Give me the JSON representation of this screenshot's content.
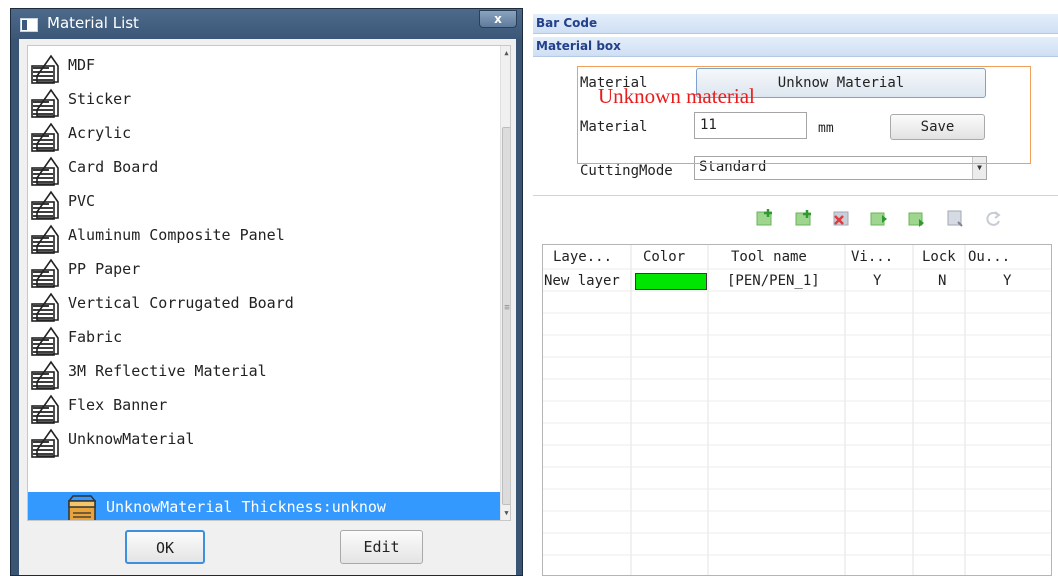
{
  "dialog": {
    "title": "Material List",
    "close_label": "x",
    "materials": [
      "MDF",
      "Sticker",
      "Acrylic",
      "Card Board",
      "PVC",
      "Aluminum Composite Panel",
      "PP Paper",
      "Vertical Corrugated Board",
      "Fabric",
      "3M Reflective Material",
      "Flex Banner",
      "UnknowMaterial"
    ],
    "selected_child": "UnknowMaterial Thickness:unknow",
    "ok_label": "OK",
    "edit_label": "Edit"
  },
  "panel": {
    "barcode_title": "Bar Code",
    "material_box_title": "Material box",
    "material_label": "Material",
    "material_button": "Unknow Material",
    "thickness_label": "Material",
    "thickness_value": "11",
    "unit": "mm",
    "save_label": "Save",
    "cutting_mode_label": "CuttingMode",
    "cutting_mode_value": "Standard",
    "annotation": "Unknown material"
  },
  "toolbar": {
    "icons": [
      "add-layer-icon",
      "add-sublayer-icon",
      "delete-layer-icon",
      "move-up-icon",
      "move-down-icon",
      "copy-layer-icon",
      "refresh-icon"
    ]
  },
  "layers": {
    "columns": [
      "Laye...",
      "Color",
      "Tool name",
      "Vi...",
      "Lock",
      "Ou..."
    ],
    "rows": [
      {
        "name": "New layer",
        "color": "#00e600",
        "tool": "[PEN/PEN_1]",
        "visible": "Y",
        "lock": "N",
        "output": "Y"
      }
    ]
  },
  "colors": {
    "selection": "#3399ff",
    "title_bar": "#3c5777",
    "band_text": "#22418a",
    "annotation": "#e81c1c",
    "layer_color": "#00e600"
  }
}
